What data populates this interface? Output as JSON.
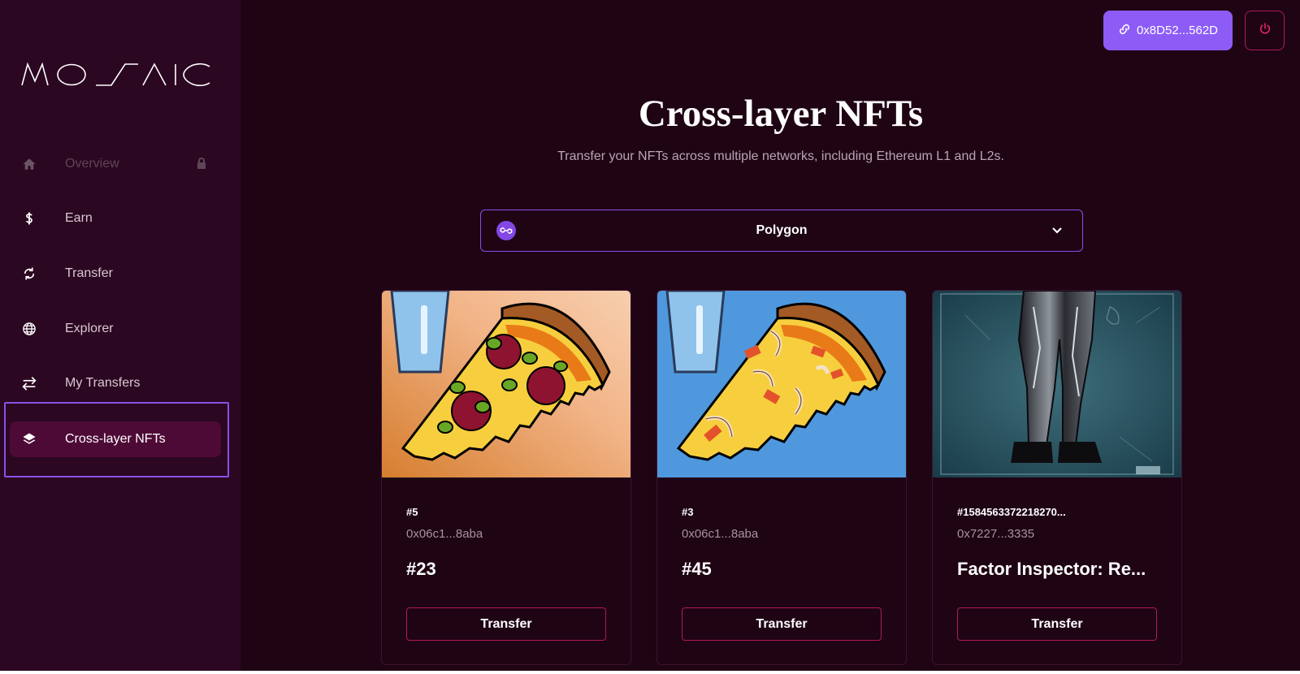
{
  "brand": {
    "name": "MOSAIC"
  },
  "sidebar": {
    "items": [
      {
        "label": "Overview",
        "icon": "home-icon",
        "state": "disabled"
      },
      {
        "label": "Earn",
        "icon": "dollar-icon",
        "state": "normal"
      },
      {
        "label": "Transfer",
        "icon": "refresh-icon",
        "state": "normal"
      },
      {
        "label": "Explorer",
        "icon": "globe-icon",
        "state": "normal"
      },
      {
        "label": "My Transfers",
        "icon": "swap-arrows-icon",
        "state": "normal"
      },
      {
        "label": "Cross-layer NFTs",
        "icon": "layers-icon",
        "state": "active"
      }
    ]
  },
  "header": {
    "wallet_address": "0x8D52...562D",
    "wallet_icon": "link-icon",
    "power_icon": "power-icon"
  },
  "main": {
    "title": "Cross-layer NFTs",
    "subtitle": "Transfer your NFTs across multiple networks, including Ethereum L1 and L2s.",
    "network_select": {
      "value": "Polygon",
      "icon": "polygon-icon"
    }
  },
  "cards": [
    {
      "id": "#5",
      "address": "0x06c1...8aba",
      "name": "#23",
      "button_label": "Transfer",
      "image": "pizza-pepperoni-orange"
    },
    {
      "id": "#3",
      "address": "0x06c1...8aba",
      "name": "#45",
      "button_label": "Transfer",
      "image": "pizza-onion-blue"
    },
    {
      "id": "#1584563372218270...",
      "address": "0x7227...3335",
      "name": "Factor Inspector: Re...",
      "button_label": "Transfer",
      "image": "character-legs-teal"
    }
  ],
  "colors": {
    "background": "#1f0414",
    "sidebar": "#2c0721",
    "accent_purple": "#8d5cf6",
    "accent_magenta": "#b01a5a",
    "active_item": "#4e0a36"
  }
}
